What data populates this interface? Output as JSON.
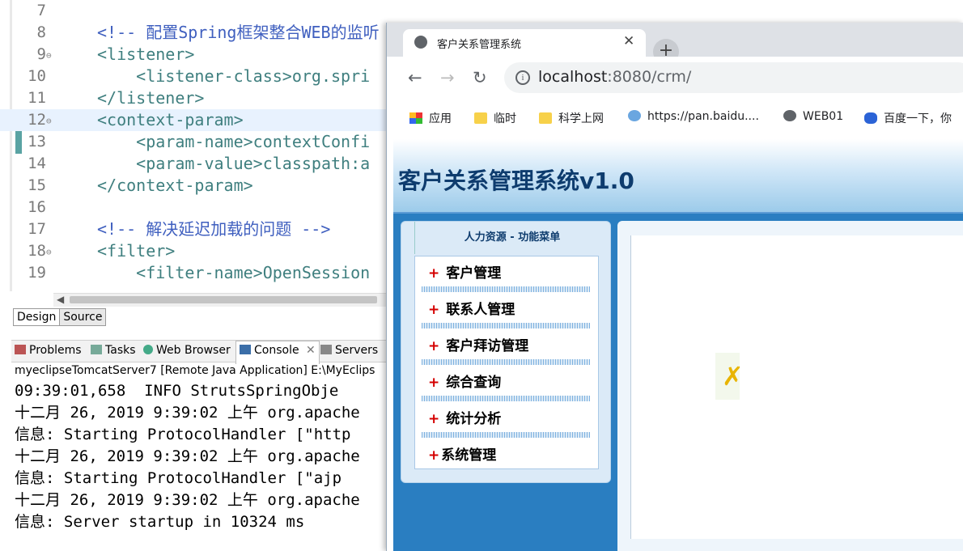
{
  "editor": {
    "lines": [
      {
        "num": "7",
        "text": "",
        "cls": "txt-b",
        "fold": ""
      },
      {
        "num": "8",
        "text": "<!-- 配置Spring框架整合WEB的监听",
        "cls": "cm",
        "fold": ""
      },
      {
        "num": "9",
        "text": "<listener>",
        "cls": "tag",
        "fold": "⊖"
      },
      {
        "num": "10",
        "text": "    <listener-class>org.spri",
        "cls": "tag",
        "fold": ""
      },
      {
        "num": "11",
        "text": "</listener>",
        "cls": "tag",
        "fold": ""
      },
      {
        "num": "12",
        "text": "<context-param>",
        "cls": "tag",
        "fold": "⊖"
      },
      {
        "num": "13",
        "text": "    <param-name>contextConfi",
        "cls": "tag",
        "fold": ""
      },
      {
        "num": "14",
        "text": "    <param-value>classpath:a",
        "cls": "tag",
        "fold": ""
      },
      {
        "num": "15",
        "text": "</context-param>",
        "cls": "tag",
        "fold": ""
      },
      {
        "num": "16",
        "text": "",
        "cls": "txt-b",
        "fold": ""
      },
      {
        "num": "17",
        "text": "<!-- 解决延迟加载的问题 -->",
        "cls": "cm",
        "fold": ""
      },
      {
        "num": "18",
        "text": "<filter>",
        "cls": "tag",
        "fold": "⊖"
      },
      {
        "num": "19",
        "text": "    <filter-name>OpenSession",
        "cls": "tag",
        "fold": ""
      }
    ],
    "current_line": "12"
  },
  "design_source_tabs": [
    "Design",
    "Source"
  ],
  "view_tabs": [
    {
      "label": "Problems",
      "active": false,
      "icon": "problems-icon"
    },
    {
      "label": "Tasks",
      "active": false,
      "icon": "tasks-icon"
    },
    {
      "label": "Web Browser",
      "active": false,
      "icon": "globe-icon"
    },
    {
      "label": "Console",
      "active": true,
      "icon": "console-icon"
    },
    {
      "label": "Servers",
      "active": false,
      "icon": "servers-icon"
    }
  ],
  "console": {
    "title": "myeclipseTomcatServer7 [Remote Java Application] E:\\MyEclips",
    "lines": [
      "09:39:01,658  INFO StrutsSpringObje",
      "十二月 26, 2019 9:39:02 上午 org.apache",
      "信息: Starting ProtocolHandler [\"http",
      "十二月 26, 2019 9:39:02 上午 org.apache",
      "信息: Starting ProtocolHandler [\"ajp",
      "十二月 26, 2019 9:39:02 上午 org.apache",
      "信息: Server startup in 10324 ms"
    ]
  },
  "browser": {
    "tab_title": "客户关系管理系统",
    "url_host": "localhost",
    "url_rest": ":8080/crm/",
    "bookmarks": [
      {
        "label": "应用",
        "icon": "apps-grid-icon"
      },
      {
        "label": "临时",
        "icon": "folder-icon"
      },
      {
        "label": "科学上网",
        "icon": "folder-icon"
      },
      {
        "label": "https://pan.baidu....",
        "icon": "baidu-pan-icon"
      },
      {
        "label": "WEB01",
        "icon": "globe-icon"
      },
      {
        "label": "百度一下，你",
        "icon": "baidu-paw-icon"
      }
    ]
  },
  "page": {
    "title": "客户关系管理系统v1.0",
    "menu_head": "人力资源  - 功能菜单",
    "menu_items": [
      "客户管理",
      "联系人管理",
      "客户拜访管理",
      "综合查询",
      "统计分析",
      "系统管理"
    ]
  },
  "colors": {
    "accent": "#2a7ec1",
    "title": "#0e3c6e",
    "plus": "#d40000"
  }
}
